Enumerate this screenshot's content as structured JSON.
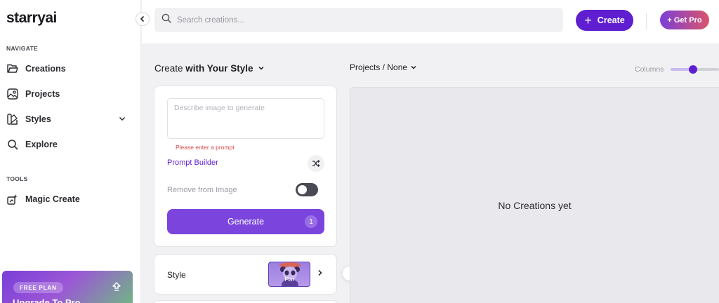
{
  "app": {
    "name": "starryai"
  },
  "sidebar": {
    "navigate_label": "NAVIGATE",
    "nav_items": [
      {
        "label": "Creations",
        "icon": "folder-icon"
      },
      {
        "label": "Projects",
        "icon": "image-icon"
      },
      {
        "label": "Styles",
        "icon": "palette-icon",
        "expandable": true
      },
      {
        "label": "Explore",
        "icon": "search-icon"
      }
    ],
    "tools_label": "TOOLS",
    "tool_items": [
      {
        "label": "Magic Create",
        "icon": "magic-wand-icon"
      }
    ],
    "upgrade": {
      "badge": "FREE PLAN",
      "title": "Upgrade To Pro",
      "icon": "upgrade-arrow-icon"
    }
  },
  "topbar": {
    "search_placeholder": "Search creations...",
    "create_label": "Create",
    "get_pro_label": "+ Get Pro"
  },
  "create_panel": {
    "heading_prefix": "Create",
    "heading_bold": "with Your Style",
    "prompt_placeholder": "Describe image to generate",
    "prompt_value": "",
    "prompt_error": "Please enter a prompt",
    "prompt_builder_label": "Prompt Builder",
    "remove_from_image_label": "Remove from Image",
    "remove_from_image_enabled": false,
    "generate_label": "Generate",
    "generate_cost": "1",
    "style_label": "Style",
    "style_selected": "Flat"
  },
  "results": {
    "projects_filter": "Projects / None",
    "columns_label": "Columns",
    "columns_value_fraction": 0.4,
    "empty_message": "No Creations yet"
  },
  "colors": {
    "accent": "#5f1fd1",
    "generate": "#7b45dd",
    "error": "#d64545"
  }
}
